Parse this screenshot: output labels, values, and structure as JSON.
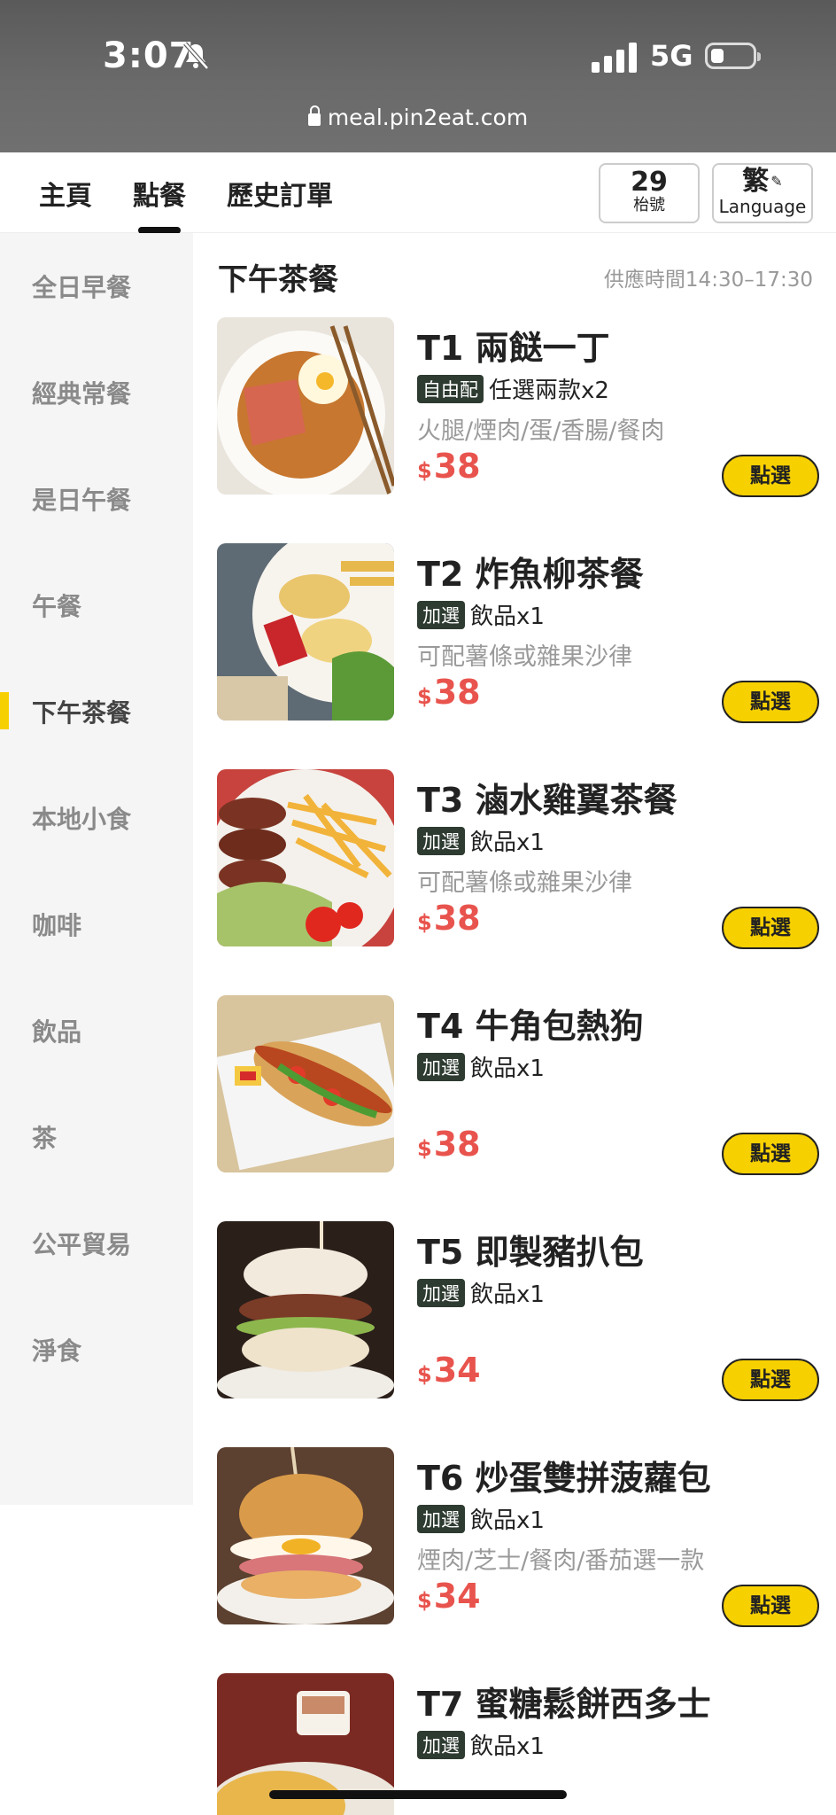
{
  "status_bar": {
    "time": "3:07",
    "network": "5G"
  },
  "browser": {
    "url": "meal.pin2eat.com"
  },
  "nav": {
    "tabs": [
      {
        "label": "主頁"
      },
      {
        "label": "點餐"
      },
      {
        "label": "歷史訂單"
      }
    ],
    "active_tab": "點餐",
    "table": {
      "number": "29",
      "label": "枱號"
    },
    "language": {
      "char": "繁",
      "label": "Language"
    }
  },
  "sidebar": {
    "categories": [
      "全日早餐",
      "經典常餐",
      "是日午餐",
      "午餐",
      "下午茶餐",
      "本地小食",
      "咖啡",
      "飲品",
      "茶",
      "公平貿易",
      "淨食"
    ],
    "active": "下午茶餐"
  },
  "section": {
    "title": "下午茶餐",
    "hours": "供應時間14:30–17:30"
  },
  "currency": "$",
  "select_label": "點選",
  "items": [
    {
      "name": "T1 兩餸一丁",
      "tag": "自由配",
      "tag_text": "任選兩款x2",
      "desc": "火腿/煙肉/蛋/香腸/餐肉",
      "price": "38"
    },
    {
      "name": "T2 炸魚柳茶餐",
      "tag": "加選",
      "tag_text": "飲品x1",
      "desc": "可配薯條或雜果沙律",
      "price": "38"
    },
    {
      "name": "T3 滷水雞翼茶餐",
      "tag": "加選",
      "tag_text": "飲品x1",
      "desc": "可配薯條或雜果沙律",
      "price": "38"
    },
    {
      "name": "T4 牛角包熱狗",
      "tag": "加選",
      "tag_text": "飲品x1",
      "desc": "",
      "price": "38"
    },
    {
      "name": "T5 即製豬扒包",
      "tag": "加選",
      "tag_text": "飲品x1",
      "desc": "",
      "price": "34"
    },
    {
      "name": "T6 炒蛋雙拼菠蘿包",
      "tag": "加選",
      "tag_text": "飲品x1",
      "desc": "煙肉/芝士/餐肉/番茄選一款",
      "price": "34"
    },
    {
      "name": "T7 蜜糖鬆餅西多士",
      "tag": "加選",
      "tag_text": "飲品x1",
      "desc": "",
      "price": ""
    }
  ],
  "colors": {
    "accent": "#f7d000",
    "price": "#e8544d",
    "tag_bg": "#2e3b31"
  }
}
